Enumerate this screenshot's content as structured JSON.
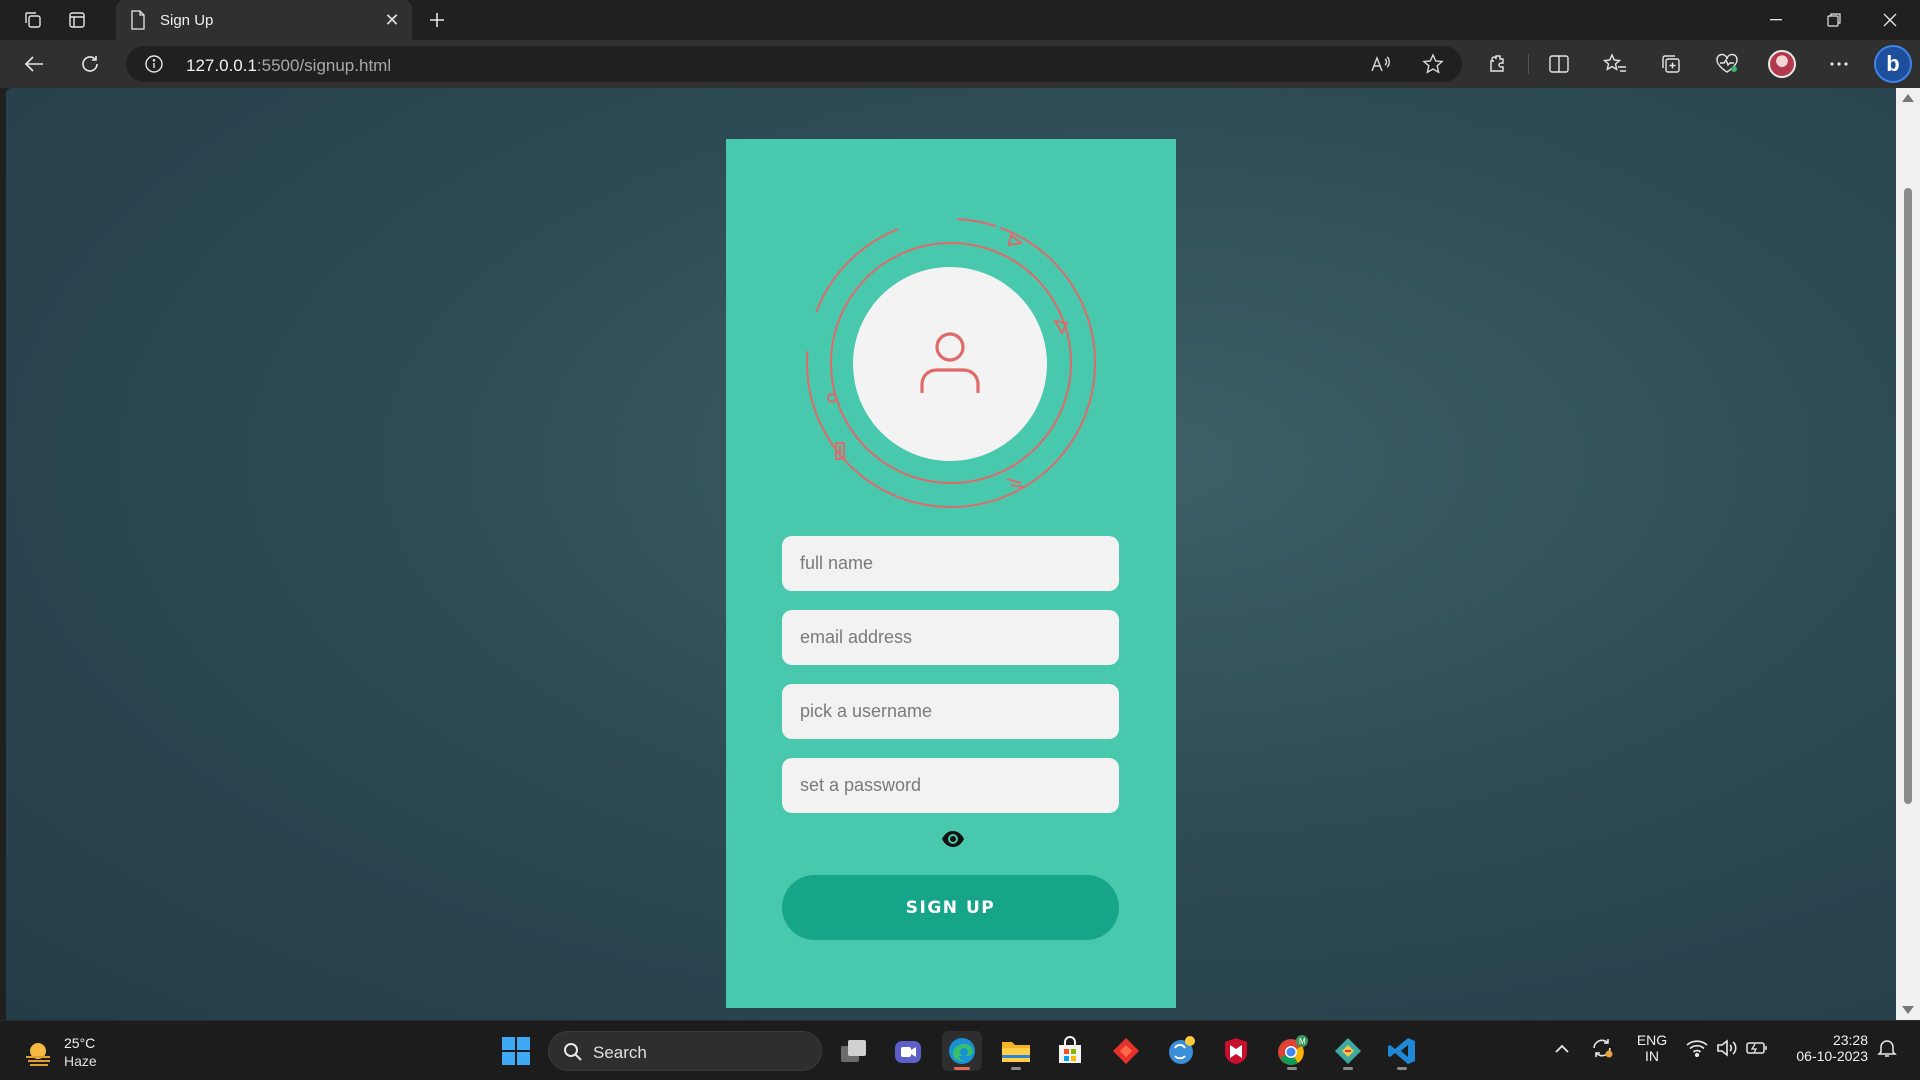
{
  "browser": {
    "tab_title": "Sign Up",
    "url_host": "127.0.0.1",
    "url_rest": ":5500/signup.html"
  },
  "form": {
    "fullname_placeholder": "full name",
    "email_placeholder": "email address",
    "username_placeholder": "pick a username",
    "password_placeholder": "set a password",
    "signup_label": "SIGN UP"
  },
  "taskbar": {
    "weather_temp": "25°C",
    "weather_condition": "Haze",
    "search_label": "Search",
    "lang_line1": "ENG",
    "lang_line2": "IN",
    "time": "23:28",
    "date": "06-10-2023"
  },
  "colors": {
    "card": "#48c9ae",
    "button": "#17a589",
    "ring": "#e06a6a",
    "page_bg": "#2e4c56"
  },
  "icons": [
    "workspaces-icon",
    "tab-actions-icon",
    "page-icon",
    "close-icon",
    "new-tab-icon",
    "minimize-icon",
    "restore-icon",
    "window-close-icon",
    "back-icon",
    "refresh-icon",
    "info-icon",
    "read-aloud-icon",
    "favorite-star-icon",
    "extensions-icon",
    "split-screen-icon",
    "favorites-icon",
    "collections-icon",
    "browser-essentials-icon",
    "more-icon",
    "bing-icon",
    "user-icon",
    "eye-icon",
    "weather-icon",
    "windows-start-icon",
    "search-icon"
  ]
}
